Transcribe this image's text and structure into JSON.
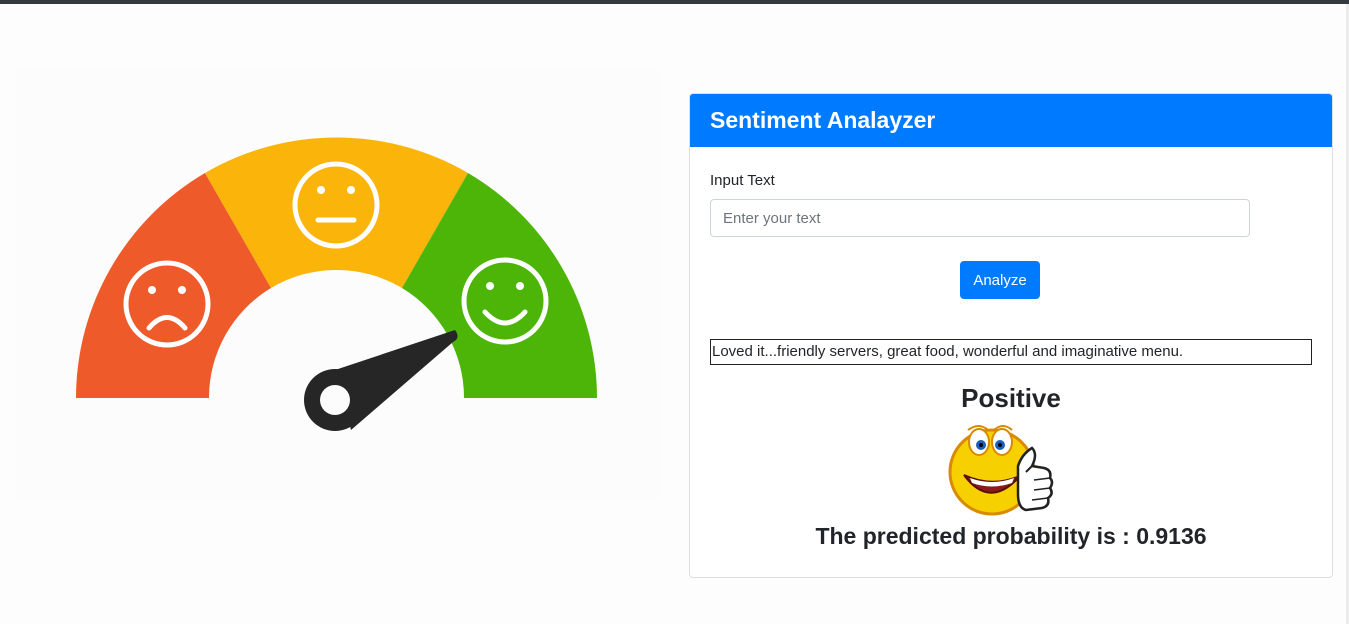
{
  "card": {
    "title": "Sentiment Analayzer",
    "input_label": "Input Text",
    "input_placeholder": "Enter your text",
    "input_value": "",
    "analyze_label": "Analyze"
  },
  "result": {
    "review_text": "Loved it...friendly servers, great food, wonderful and imaginative menu.",
    "sentiment_label": "Positive",
    "probability_prefix": "The predicted probability is : ",
    "probability_value": "0.9136"
  },
  "gauge": {
    "colors": {
      "negative": "#ef5a2a",
      "neutral": "#fbb40a",
      "positive": "#4cb508",
      "needle": "#262626"
    },
    "icons": [
      "sad-face-icon",
      "neutral-face-icon",
      "happy-face-icon"
    ]
  },
  "theme": {
    "primary": "#007bff",
    "topbar": "#343a40"
  }
}
